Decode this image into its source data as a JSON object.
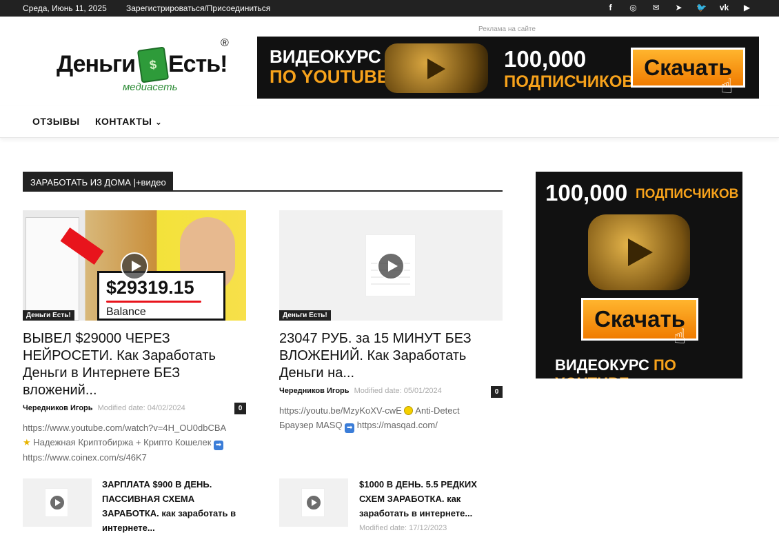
{
  "topbar": {
    "date": "Среда, Июнь 11, 2025",
    "register": "Зарегистрироваться/Присоединиться",
    "social": [
      {
        "icon": "facebook-icon",
        "glyph": "f"
      },
      {
        "icon": "instagram-icon",
        "glyph": "◎"
      },
      {
        "icon": "mail-icon",
        "glyph": "✉"
      },
      {
        "icon": "telegram-icon",
        "glyph": "➤"
      },
      {
        "icon": "twitter-icon",
        "glyph": "🐦"
      },
      {
        "icon": "vk-icon",
        "glyph": "vk"
      },
      {
        "icon": "youtube-icon",
        "glyph": "▶"
      }
    ]
  },
  "header": {
    "ad_label": "Реклама на сайте",
    "logo": {
      "word1": "Деньги",
      "word2": "Есть!",
      "sub": "медиасеть",
      "reg": "®"
    },
    "banner": {
      "line1": "ВИДЕОКУРС",
      "line2": "ПО YOUTUBE",
      "count": "100,000",
      "subs": "ПОДПИСЧИКОВ",
      "button": "Скачать"
    }
  },
  "nav": {
    "items": [
      "ОТЗЫВЫ",
      "КОНТАКТЫ"
    ],
    "chevron": "⌄"
  },
  "section": {
    "title": "ЗАРАБОТАТЬ ИЗ ДОМА |+видео"
  },
  "posts": [
    {
      "category": "Деньги Есть!",
      "thumb_amount": "$29319.15",
      "thumb_caption": "Balance",
      "title": "ВЫВЕЛ $29000 ЧЕРЕЗ НЕЙРОСЕТИ. Как Заработать Деньги в Интернете БЕЗ вложений...",
      "author": "Чередников Игорь",
      "date_label": "Modified date: 04/02/2024",
      "comments": "0",
      "excerpt_line1": "https://www.youtube.com/watch?v=4H_OU0dbCBA",
      "excerpt_line2": "Надежная Криптобиржа + Крипто Кошелек",
      "excerpt_line3": "https://www.coinex.com/s/46K7"
    },
    {
      "category": "Деньги Есть!",
      "title": "23047 РУБ. за 15 МИНУТ БЕЗ ВЛОЖЕНИЙ. Как Заработать Деньги на...",
      "author": "Чередников Игорь",
      "date_label": "Modified date: 05/01/2024",
      "comments": "0",
      "excerpt_line1": "https://youtu.be/MzyKoXV-cwE",
      "excerpt_line1b": "Anti-Detect",
      "excerpt_line2": "Браузер MASQ",
      "excerpt_line2b": "https://masqad.com/"
    }
  ],
  "small_posts": [
    {
      "title": "ЗАРПЛАТА $900 В ДЕНЬ. ПАССИВНАЯ СХЕМА ЗАРАБОТКА. как заработать в интернете..."
    },
    {
      "title": "$1000 В ДЕНЬ. 5.5 РЕДКИХ СХЕМ ЗАРАБОТКА. как заработать в интернете...",
      "date_label": "Modified date: 17/12/2023"
    }
  ],
  "sidebar_banner": {
    "count": "100,000",
    "subs": "ПОДПИСЧИКОВ",
    "button": "Скачать",
    "bottom1": "ВИДЕОКУРС",
    "bottom2": "ПО YOUTUBE"
  },
  "colors": {
    "accent": "#f7a21b",
    "dark": "#222222",
    "logo_green": "#2a8a33"
  }
}
